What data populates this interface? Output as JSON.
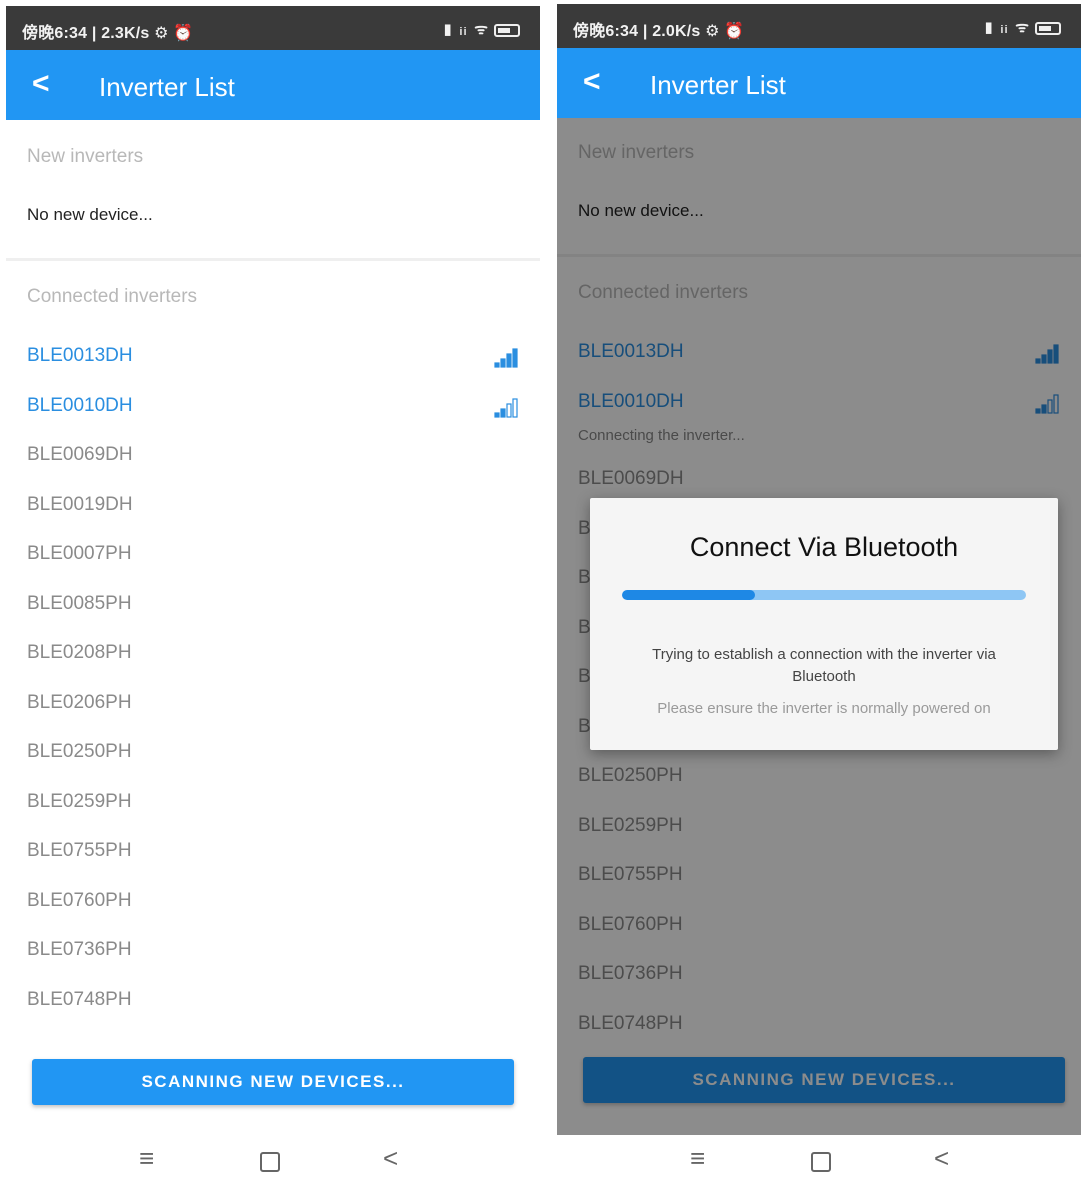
{
  "left": {
    "status_time": "傍晚6:34 | 2.3K/s ⚙ ⏰",
    "status_icons": "▮ ᵢᵢ ᯤ",
    "title": "Inverter List",
    "new_label": "New inverters",
    "no_device": "No new device...",
    "connected_label": "Connected inverters",
    "devices": [
      {
        "name": "BLE0013DH",
        "connected": true,
        "signal": 4
      },
      {
        "name": "BLE0010DH",
        "connected": true,
        "signal": 2
      },
      {
        "name": "BLE0069DH",
        "connected": false
      },
      {
        "name": "BLE0019DH",
        "connected": false
      },
      {
        "name": "BLE0007PH",
        "connected": false
      },
      {
        "name": "BLE0085PH",
        "connected": false
      },
      {
        "name": "BLE0208PH",
        "connected": false
      },
      {
        "name": "BLE0206PH",
        "connected": false
      },
      {
        "name": "BLE0250PH",
        "connected": false
      },
      {
        "name": "BLE0259PH",
        "connected": false
      },
      {
        "name": "BLE0755PH",
        "connected": false
      },
      {
        "name": "BLE0760PH",
        "connected": false
      },
      {
        "name": "BLE0736PH",
        "connected": false
      },
      {
        "name": "BLE0748PH",
        "connected": false
      }
    ],
    "scan_button": "SCANNING NEW DEVICES..."
  },
  "right": {
    "status_time": "傍晚6:34 | 2.0K/s ⚙ ⏰",
    "status_icons": "▮ ᵢᵢ ᯤ",
    "title": "Inverter List",
    "new_label": "New inverters",
    "no_device": "No new device...",
    "connected_label": "Connected inverters",
    "devices": [
      {
        "name": "BLE0013DH",
        "connected": true,
        "signal": 4
      },
      {
        "name": "BLE0010DH",
        "connected": true,
        "signal": 2
      },
      {
        "name": "BLE0069DH",
        "connected": false
      },
      {
        "name": "BLE0019DH",
        "connected": false
      },
      {
        "name": "BLE0007PH",
        "connected": false
      },
      {
        "name": "BLE0085PH",
        "connected": false
      },
      {
        "name": "BLE0208PH",
        "connected": false
      },
      {
        "name": "BLE0206PH",
        "connected": false
      },
      {
        "name": "BLE0250PH",
        "connected": false
      },
      {
        "name": "BLE0259PH",
        "connected": false
      },
      {
        "name": "BLE0755PH",
        "connected": false
      },
      {
        "name": "BLE0760PH",
        "connected": false
      },
      {
        "name": "BLE0736PH",
        "connected": false
      },
      {
        "name": "BLE0748PH",
        "connected": false
      }
    ],
    "connecting_text": "Connecting the inverter...",
    "scan_button": "SCANNING NEW DEVICES...",
    "dialog": {
      "title": "Connect Via Bluetooth",
      "progress": 0.33,
      "message": "Trying to establish a connection with the inverter via Bluetooth",
      "hint": "Please ensure the inverter is normally powered on"
    }
  },
  "nav": {
    "menu_glyph": "≡",
    "back_glyph": "<"
  },
  "colors": {
    "accent": "#2196f3",
    "connected_text": "#2a8ee0"
  }
}
